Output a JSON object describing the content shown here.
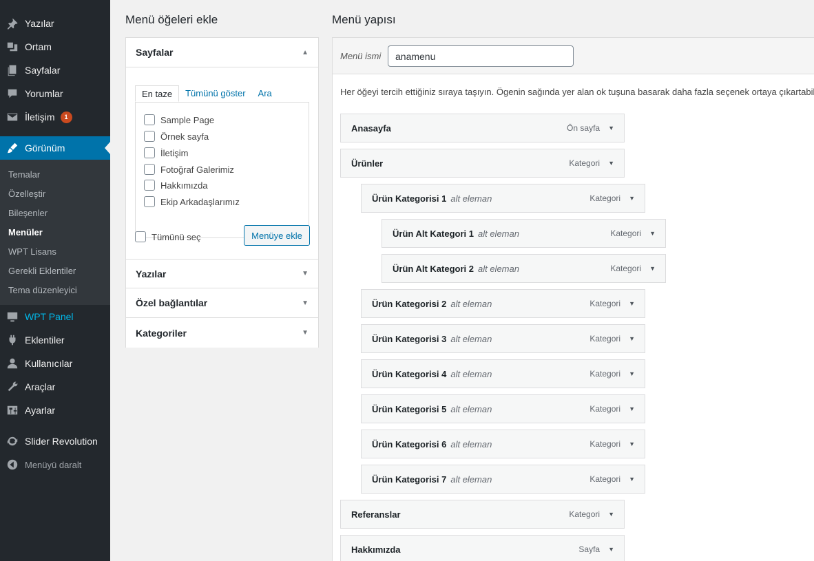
{
  "sidebar": {
    "items": [
      {
        "label": "Yazılar",
        "icon": "pin-icon"
      },
      {
        "label": "Ortam",
        "icon": "media-icon"
      },
      {
        "label": "Sayfalar",
        "icon": "pages-icon"
      },
      {
        "label": "Yorumlar",
        "icon": "comment-icon"
      },
      {
        "label": "İletişim",
        "icon": "mail-icon",
        "badge": "1"
      },
      {
        "label": "Görünüm",
        "icon": "brush-icon",
        "active": true
      },
      {
        "label": "WPT Panel",
        "icon": "monitor-icon"
      },
      {
        "label": "Eklentiler",
        "icon": "plugin-icon"
      },
      {
        "label": "Kullanıcılar",
        "icon": "user-icon"
      },
      {
        "label": "Araçlar",
        "icon": "wrench-icon"
      },
      {
        "label": "Ayarlar",
        "icon": "settings-icon"
      },
      {
        "label": "Slider Revolution",
        "icon": "refresh-icon"
      },
      {
        "label": "Menüyü daralt",
        "icon": "collapse-icon"
      }
    ],
    "submenu": [
      "Temalar",
      "Özelleştir",
      "Bileşenler",
      "Menüler",
      "WPT Lisans",
      "Gerekli Eklentiler",
      "Tema düzenleyici"
    ],
    "submenu_current": "Menüler"
  },
  "left": {
    "title": "Menü öğeleri ekle",
    "panels": [
      "Sayfalar",
      "Yazılar",
      "Özel bağlantılar",
      "Kategoriler"
    ],
    "tabs": [
      "En taze",
      "Tümünü göster",
      "Ara"
    ],
    "pages": [
      "Sample Page",
      "Örnek sayfa",
      "İletişim",
      "Fotoğraf Galerimiz",
      "Hakkımızda",
      "Ekip Arkadaşlarımız"
    ],
    "select_all": "Tümünü seç",
    "add_button": "Menüye ekle"
  },
  "right": {
    "title": "Menü yapısı",
    "name_label": "Menü ismi",
    "name_value": "anamenu",
    "instructions": "Her öğeyi tercih ettiğiniz sıraya taşıyın. Ögenin sağında yer alan ok tuşuna basarak daha fazla seçenek ortaya çıkartabilirsiniz.",
    "items": [
      {
        "title": "Anasayfa",
        "sub": "",
        "type": "Ön sayfa",
        "depth": 0
      },
      {
        "title": "Ürünler",
        "sub": "",
        "type": "Kategori",
        "depth": 0
      },
      {
        "title": "Ürün Kategorisi 1",
        "sub": "alt eleman",
        "type": "Kategori",
        "depth": 1
      },
      {
        "title": "Ürün Alt Kategori 1",
        "sub": "alt eleman",
        "type": "Kategori",
        "depth": 2
      },
      {
        "title": "Ürün Alt Kategori 2",
        "sub": "alt eleman",
        "type": "Kategori",
        "depth": 2
      },
      {
        "title": "Ürün Kategorisi 2",
        "sub": "alt eleman",
        "type": "Kategori",
        "depth": 1
      },
      {
        "title": "Ürün Kategorisi 3",
        "sub": "alt eleman",
        "type": "Kategori",
        "depth": 1
      },
      {
        "title": "Ürün Kategorisi 4",
        "sub": "alt eleman",
        "type": "Kategori",
        "depth": 1
      },
      {
        "title": "Ürün Kategorisi 5",
        "sub": "alt eleman",
        "type": "Kategori",
        "depth": 1
      },
      {
        "title": "Ürün Kategorisi 6",
        "sub": "alt eleman",
        "type": "Kategori",
        "depth": 1
      },
      {
        "title": "Ürün Kategorisi 7",
        "sub": "alt eleman",
        "type": "Kategori",
        "depth": 1
      },
      {
        "title": "Referanslar",
        "sub": "",
        "type": "Kategori",
        "depth": 0
      },
      {
        "title": "Hakkımızda",
        "sub": "",
        "type": "Sayfa",
        "depth": 0
      }
    ]
  },
  "colors": {
    "sidebar": "#23282d",
    "submenu": "#32373c",
    "accent": "#0073aa",
    "badge": "#ca4a1f",
    "wpt": "#00b9eb"
  }
}
